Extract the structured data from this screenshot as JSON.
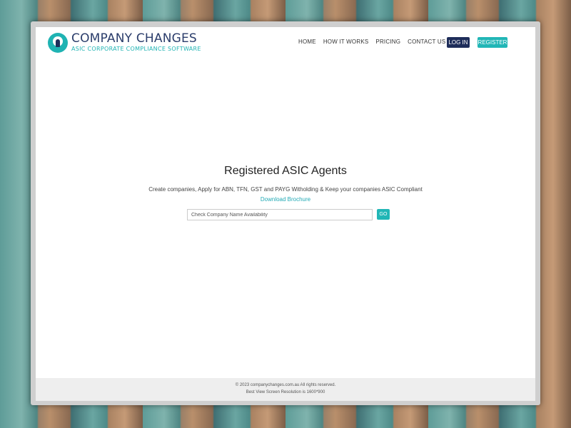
{
  "brand": {
    "name": "COMPANY CHANGES",
    "tagline": "ASIC CORPORATE COMPLIANCE SOFTWARE",
    "accent_color": "#21b6b6",
    "primary_color": "#1e2d5a"
  },
  "nav": {
    "items": [
      {
        "label": "HOME"
      },
      {
        "label": "HOW IT WORKS"
      },
      {
        "label": "PRICING"
      },
      {
        "label": "CONTACT US"
      }
    ],
    "login_label": "LOG IN",
    "register_label": "REGISTER"
  },
  "hero": {
    "title": "Registered ASIC Agents",
    "subtitle": "Create companies, Apply for ABN, TFN, GST and PAYG Witholding & Keep your companies ASIC Compliant",
    "link_label": "Download Brochure"
  },
  "search": {
    "placeholder": "Check Company Name Availability",
    "value": "",
    "button_label": "GO"
  },
  "footer": {
    "copyright": "© 2023 companychanges.com.au All rights reserved.",
    "resolution_note": "Best View Screen Resolution is 1600*900"
  }
}
